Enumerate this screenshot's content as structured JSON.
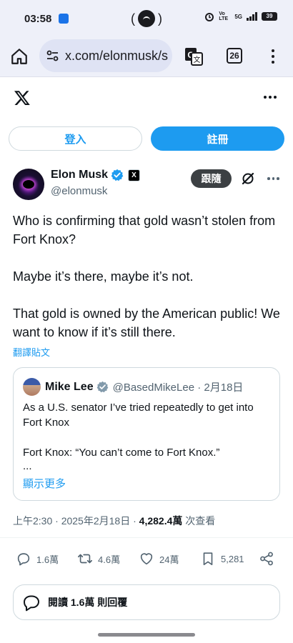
{
  "status_bar": {
    "time": "03:58",
    "center_text_left": "(",
    "center_text_right": ")",
    "net_label": "Vo LTE",
    "signal_label": "5G",
    "battery": "39"
  },
  "browser": {
    "url": "x.com/elonmusk/s",
    "tab_count": "26"
  },
  "auth": {
    "login": "登入",
    "signup": "註冊"
  },
  "post": {
    "author_name": "Elon Musk",
    "affiliate_badge": "X",
    "handle": "@elonmusk",
    "follow_label": "跟隨",
    "paragraphs": [
      "Who is confirming that gold wasn’t stolen from Fort Knox?",
      "Maybe it’s there, maybe it’s not.",
      "That gold is owned by the American public! We want to know if it’s still there."
    ],
    "translate_label": "翻譯貼文",
    "meta": {
      "time": "上午2:30",
      "sep1": " · ",
      "date": "2025年2月18日",
      "sep2": " · ",
      "views": "4,282.4萬",
      "views_suffix": " 次查看"
    }
  },
  "quote": {
    "name": "Mike Lee",
    "handle": "@BasedMikeLee · 2月18日",
    "paragraphs": [
      "As a U.S. senator I’ve tried repeatedly to get into Fort Knox",
      "Fort Knox: “You can’t come to Fort Knox.”"
    ],
    "ellipsis": "...",
    "show_more": "顯示更多"
  },
  "actions": {
    "replies": "1.6萬",
    "reposts": "4.6萬",
    "likes": "24萬",
    "bookmarks": "5,281"
  },
  "read_replies": "閱讀 1.6萬 則回覆",
  "colors": {
    "accent": "#1d9bf0",
    "text": "#0f1419",
    "secondary": "#536471",
    "browser_chrome": "#eef0f9"
  }
}
